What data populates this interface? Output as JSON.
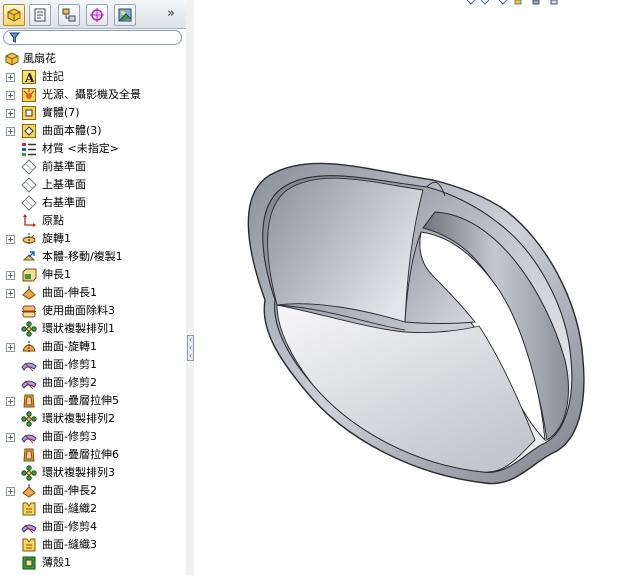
{
  "tabs": [
    {
      "icon": "feature-manager-icon",
      "active": true
    },
    {
      "icon": "property-manager-icon"
    },
    {
      "icon": "configuration-manager-icon"
    },
    {
      "icon": "dimxpert-icon"
    },
    {
      "icon": "display-manager-icon"
    }
  ],
  "more_tabs_glyph": "»",
  "filter": {
    "icon": "filter-icon"
  },
  "tree": {
    "root": "風扇花",
    "items": [
      {
        "label": "註記",
        "icon": "annotation-icon",
        "expandable": true
      },
      {
        "label": "光源、攝影機及全景",
        "icon": "lights-icon",
        "expandable": true
      },
      {
        "label": "實體(7)",
        "icon": "solid-bodies-icon",
        "expandable": true
      },
      {
        "label": "曲面本體(3)",
        "icon": "surface-bodies-icon",
        "expandable": true
      },
      {
        "label": "材質 <未指定>",
        "icon": "material-icon",
        "expandable": false
      },
      {
        "label": "前基準面",
        "icon": "plane-icon",
        "expandable": false
      },
      {
        "label": "上基準面",
        "icon": "plane-icon",
        "expandable": false
      },
      {
        "label": "右基準面",
        "icon": "plane-icon",
        "expandable": false
      },
      {
        "label": "原點",
        "icon": "origin-icon",
        "expandable": false
      },
      {
        "label": "旋轉1",
        "icon": "revolve-icon",
        "expandable": true
      },
      {
        "label": "本體-移動/複製1",
        "icon": "move-copy-icon",
        "expandable": false
      },
      {
        "label": "伸長1",
        "icon": "extrude-icon",
        "expandable": true
      },
      {
        "label": "曲面-伸長1",
        "icon": "surface-extrude-icon",
        "expandable": true
      },
      {
        "label": "使用曲面除料3",
        "icon": "cut-with-surface-icon",
        "expandable": false
      },
      {
        "label": "環狀複製排列1",
        "icon": "circular-pattern-icon",
        "expandable": false
      },
      {
        "label": "曲面-旋轉1",
        "icon": "surface-revolve-icon",
        "expandable": true
      },
      {
        "label": "曲面-修剪1",
        "icon": "surface-trim-icon",
        "expandable": false
      },
      {
        "label": "曲面-修剪2",
        "icon": "surface-trim-icon",
        "expandable": false
      },
      {
        "label": "曲面-疊層拉伸5",
        "icon": "surface-loft-icon",
        "expandable": true
      },
      {
        "label": "環狀複製排列2",
        "icon": "circular-pattern-icon",
        "expandable": false
      },
      {
        "label": "曲面-修剪3",
        "icon": "surface-trim-icon",
        "expandable": true
      },
      {
        "label": "曲面-疊層拉伸6",
        "icon": "surface-loft-icon",
        "expandable": false
      },
      {
        "label": "環狀複製排列3",
        "icon": "circular-pattern-icon",
        "expandable": false
      },
      {
        "label": "曲面-伸長2",
        "icon": "surface-extrude-icon",
        "expandable": true
      },
      {
        "label": "曲面-縫織2",
        "icon": "surface-knit-icon",
        "expandable": false
      },
      {
        "label": "曲面-修剪4",
        "icon": "surface-trim-icon",
        "expandable": false
      },
      {
        "label": "曲面-縫織3",
        "icon": "surface-knit-icon",
        "expandable": false
      },
      {
        "label": "薄殼1",
        "icon": "shell-icon",
        "expandable": false
      }
    ]
  },
  "colors": {
    "model_dark": "#6f7480",
    "model_light": "#f2f2f5",
    "model_edge": "#2a2a2e",
    "panel_border": "#9aa7b8"
  }
}
